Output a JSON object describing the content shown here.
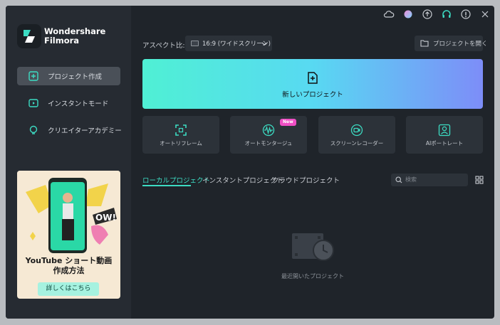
{
  "app": {
    "brand_line1": "Wondershare",
    "brand_line2": "Filmora"
  },
  "sidebar": {
    "items": [
      {
        "label": "プロジェクト作成",
        "icon": "plus-square-icon",
        "active": true
      },
      {
        "label": "インスタントモード",
        "icon": "instant-icon",
        "active": false
      },
      {
        "label": "クリエイターアカデミー",
        "icon": "bulb-icon",
        "active": false
      }
    ],
    "promo": {
      "title_line1": "YouTube ショート動画",
      "title_line2": "作成方法",
      "button": "詳しくはこちら"
    }
  },
  "titlebar": {
    "icons": [
      "cloud-icon",
      "avatar-icon",
      "upload-icon",
      "headset-icon",
      "info-icon",
      "close-icon"
    ]
  },
  "main": {
    "aspect_label": "アスペクト比:",
    "aspect_value": "16:9 (ワイドスクリーン)",
    "open_project": "プロジェクトを開く",
    "new_project": "新しいプロジェクト",
    "tiles": [
      {
        "label": "オートリフレーム",
        "icon": "reframe-icon"
      },
      {
        "label": "オートモンタージュ",
        "icon": "montage-icon",
        "badge": "New"
      },
      {
        "label": "スクリーンレコーダー",
        "icon": "screen-recorder-icon"
      },
      {
        "label": "AIポートレート",
        "icon": "portrait-icon"
      }
    ],
    "tabs": [
      {
        "label": "ローカルプロジェクト",
        "active": true
      },
      {
        "label": "インスタントプロジェクト",
        "active": false
      },
      {
        "label": "クラウドプロジェクト",
        "active": false
      }
    ],
    "search_placeholder": "検索",
    "empty_label": "最近開いたプロジェクト"
  },
  "colors": {
    "accent": "#3cdcc3",
    "background": "#1f242a",
    "sidebar": "#262b32"
  }
}
